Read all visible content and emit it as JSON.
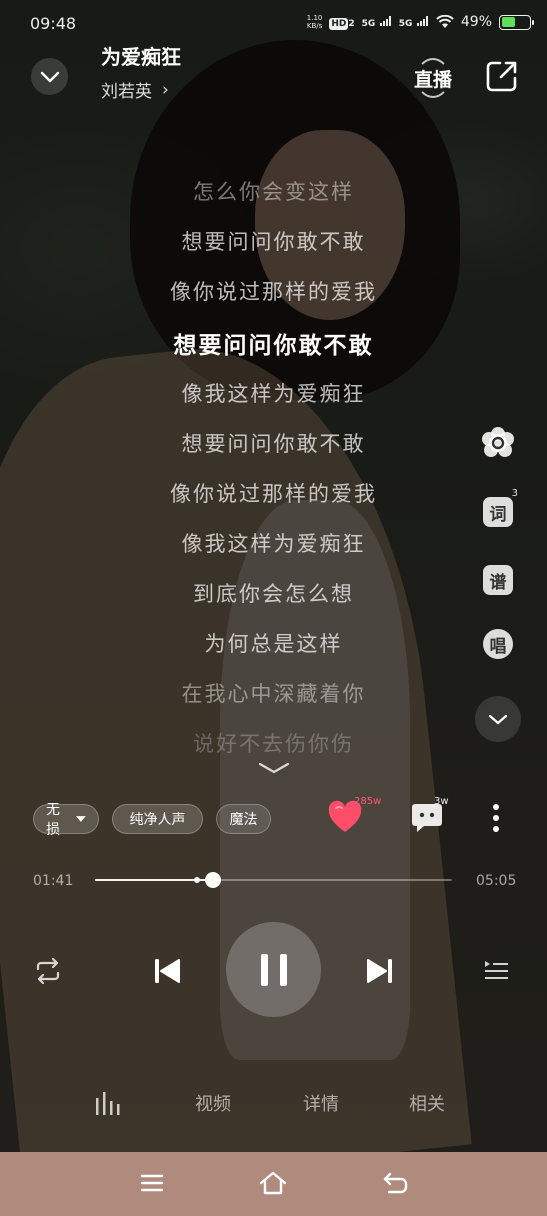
{
  "status_bar": {
    "time": "09:48",
    "net_speed_value": "1.10",
    "net_speed_unit": "KB/s",
    "hd_label": "HD",
    "hd_sub": "2",
    "sig1": "5G",
    "sig2": "5G",
    "battery_text": "49%",
    "battery_level": 0.49
  },
  "header": {
    "title": "为爱痴狂",
    "artist": "刘若英",
    "artist_arrow": "›",
    "live_label": "直播"
  },
  "lyrics": [
    {
      "text": "怎么你会变这样",
      "state": "fade1"
    },
    {
      "text": "想要问问你敢不敢",
      "state": "normal"
    },
    {
      "text": "像你说过那样的爱我",
      "state": "normal"
    },
    {
      "text": "想要问问你敢不敢",
      "state": "current"
    },
    {
      "text": "像我这样为爱痴狂",
      "state": "normal"
    },
    {
      "text": "想要问问你敢不敢",
      "state": "normal"
    },
    {
      "text": "像你说过那样的爱我",
      "state": "normal"
    },
    {
      "text": "像我这样为爱痴狂",
      "state": "normal"
    },
    {
      "text": "到底你会怎么想",
      "state": "normal"
    },
    {
      "text": "为何总是这样",
      "state": "normal"
    },
    {
      "text": "在我心中深藏着你",
      "state": "fade1"
    },
    {
      "text": "说好不去伤你伤",
      "state": "fade2"
    }
  ],
  "side_tools": {
    "lyric_label": "词",
    "lyric_sup": "3",
    "score_label": "谱",
    "sing_label": "唱"
  },
  "chips": {
    "lossless": "无损",
    "pure_vocal": "纯净人声",
    "magic": "魔法"
  },
  "social": {
    "like_count": "285w",
    "comment_count": "3w",
    "accent": "#ff4d6a"
  },
  "progress": {
    "current": "01:41",
    "total": "05:05",
    "fraction": 0.331,
    "buffered": 0.286
  },
  "tabs": {
    "video": "视频",
    "detail": "详情",
    "related": "相关"
  },
  "colors": {
    "navbar": "#b08a7c"
  }
}
